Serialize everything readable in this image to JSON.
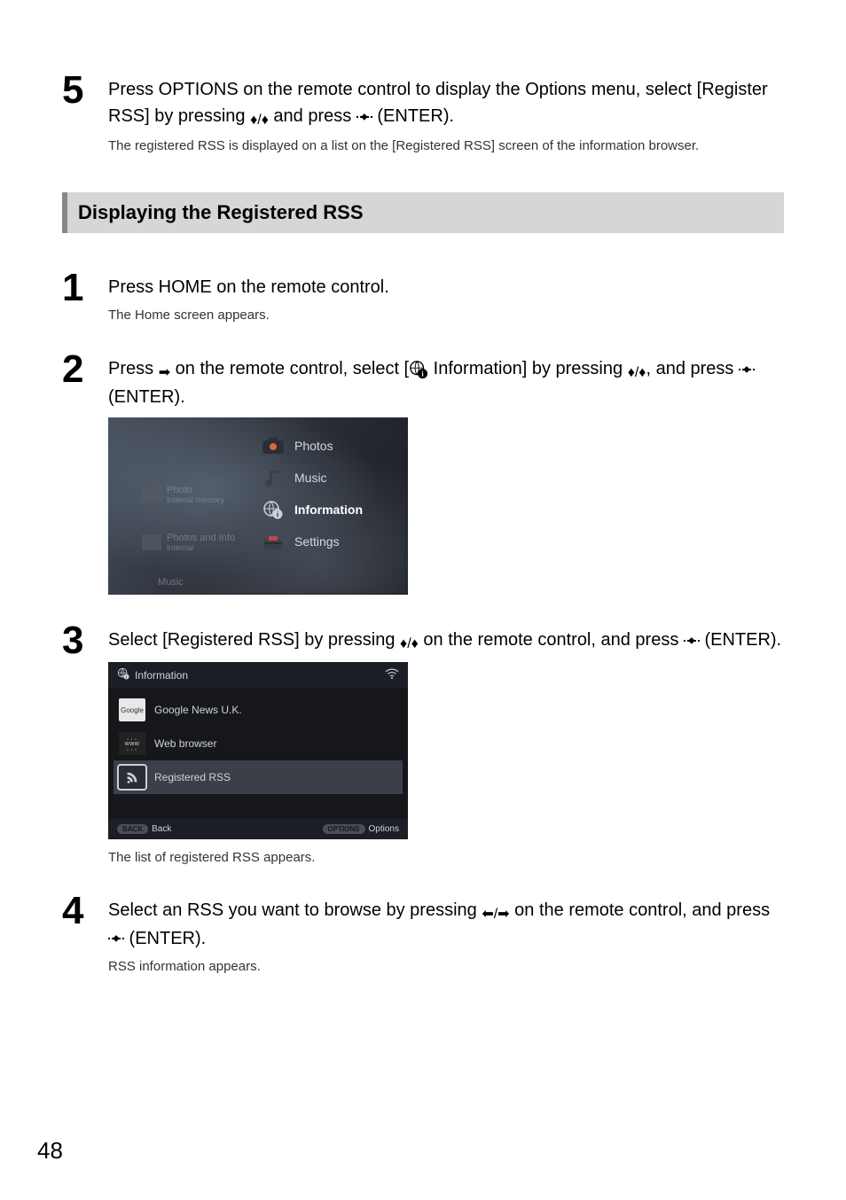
{
  "step5": {
    "num": "5",
    "line1_a": "Press OPTIONS on the remote control to display the Options menu, select ",
    "line1_b": "[Register RSS] by pressing ",
    "line1_c": " and press ",
    "line1_d": " (ENTER).",
    "note": "The registered RSS is displayed on a list on the [Registered RSS] screen of the information browser."
  },
  "section_heading": "Displaying the Registered RSS",
  "step1": {
    "num": "1",
    "line": "Press HOME on the remote control.",
    "note": "The Home screen appears."
  },
  "step2": {
    "num": "2",
    "line_a": "Press ",
    "line_b": " on the remote control, select [",
    "line_c": " Information] by pressing ",
    "line_d": ", and press ",
    "line_e": " (ENTER)."
  },
  "menu": {
    "photos": "Photos",
    "music": "Music",
    "information": "Information",
    "settings": "Settings",
    "ghost1_a": "Photo",
    "ghost1_b": "Internal memory",
    "ghost2_a": "Photos and Info",
    "ghost2_b": "Internal",
    "ghost3": "Music"
  },
  "step3": {
    "num": "3",
    "line_a": "Select [Registered RSS] by pressing ",
    "line_b": " on the remote control, and press ",
    "line_c": " (ENTER)."
  },
  "info_screen": {
    "header": "Information",
    "item1": "Google News U.K.",
    "item1_thumb": "Google",
    "item2": "Web browser",
    "item2_thumb": "www",
    "item3": "Registered RSS",
    "back_pill": "BACK",
    "back_label": "Back",
    "options_pill": "OPTIONS",
    "options_label": "Options"
  },
  "step3_note": "The list of registered RSS appears.",
  "step4": {
    "num": "4",
    "line_a": "Select an RSS you want to browse by pressing ",
    "line_b": " on the remote control, and press ",
    "line_c": " (ENTER).",
    "note": "RSS information appears."
  },
  "page_number": "48"
}
